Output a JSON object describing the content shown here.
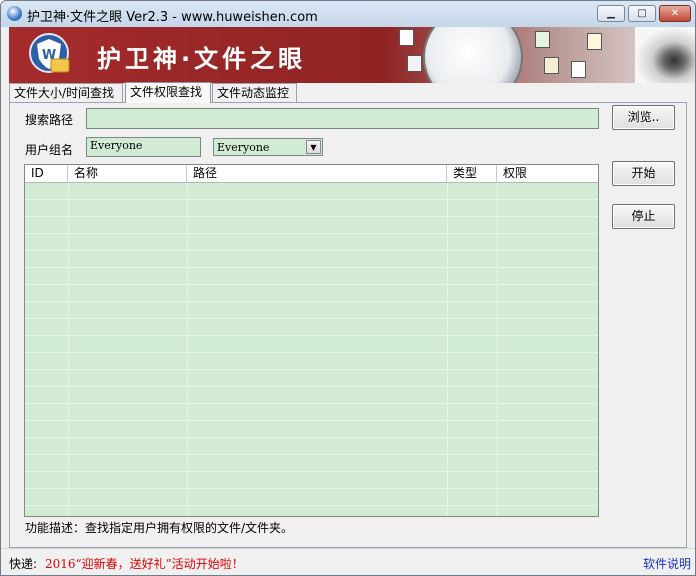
{
  "window": {
    "title": "护卫神·文件之眼 Ver2.3 - www.huweishen.com",
    "controls": {
      "minimize": "▭",
      "maximize": "□",
      "close": "✕"
    }
  },
  "banner": {
    "title": "护卫神·文件之眼",
    "logo_icon": "shield-folder-logo",
    "accent": "#a52b2c"
  },
  "tabs": [
    {
      "label": "文件大小/时间查找"
    },
    {
      "label": "文件权限查找"
    },
    {
      "label": "文件动态监控"
    }
  ],
  "form": {
    "search_path_label": "搜索路径",
    "search_path_value": "",
    "browse_label": "浏览..",
    "user_group_label": "用户组名",
    "user_group_value": "Everyone",
    "user_group_select": "Everyone"
  },
  "table": {
    "columns": [
      "ID",
      "名称",
      "路径",
      "类型",
      "权限"
    ],
    "rows": []
  },
  "buttons": {
    "start": "开始",
    "stop": "停止"
  },
  "description": "功能描述：查找指定用户拥有权限的文件/文件夹。",
  "status": {
    "label": "快递:",
    "news": "2016“迎新春，送好礼”活动开始啦！",
    "help_link": "软件说明"
  },
  "colors": {
    "field_bg": "#d2ebd5",
    "news_red": "#e00000",
    "link_blue": "#1c2fd1"
  }
}
